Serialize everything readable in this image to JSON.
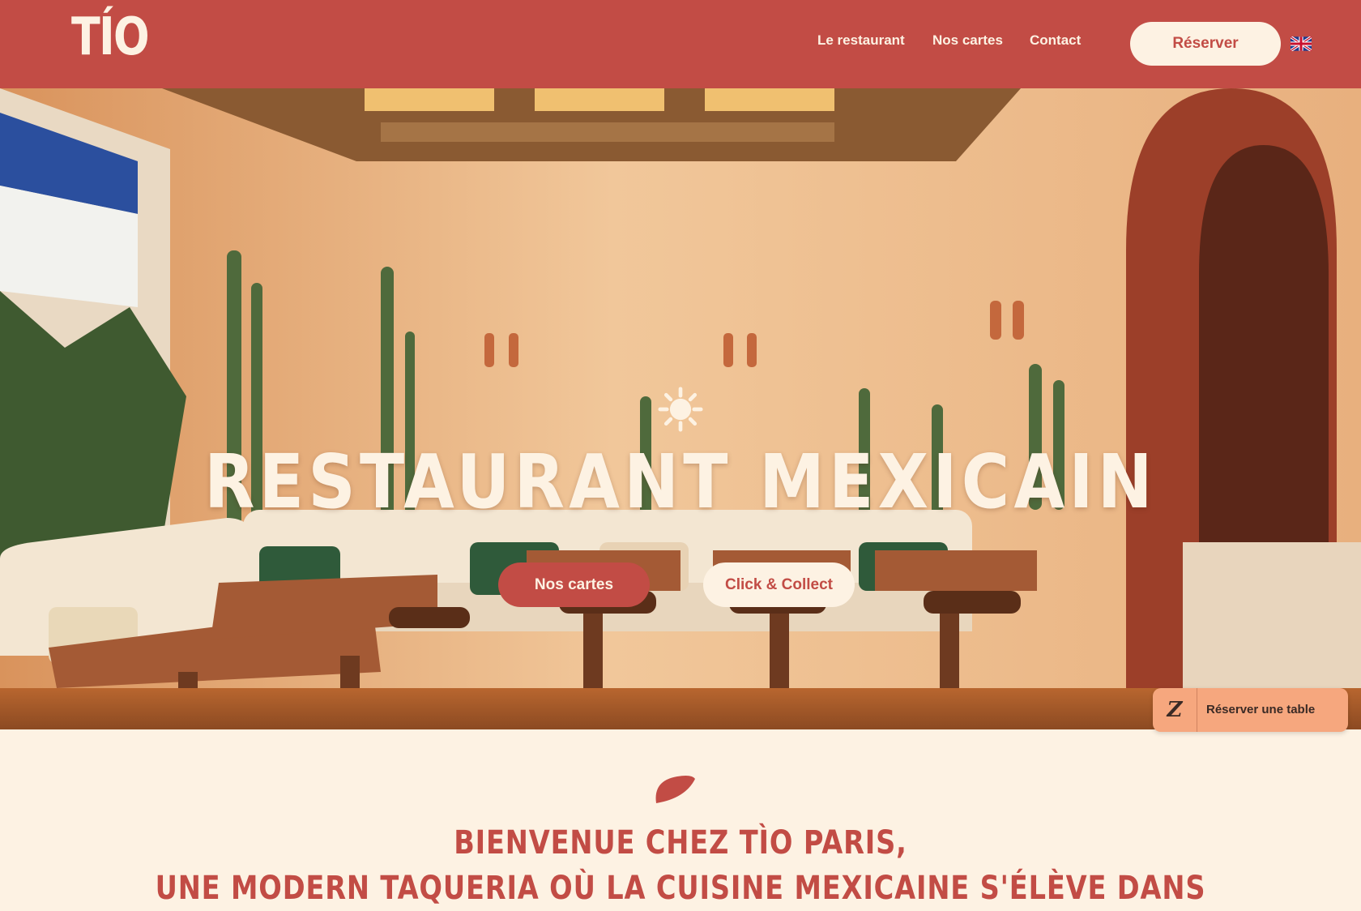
{
  "header": {
    "logo_text": "TÍO",
    "nav": [
      {
        "label": "Le restaurant"
      },
      {
        "label": "Nos cartes"
      },
      {
        "label": "Contact"
      }
    ],
    "reserve_label": "Réserver",
    "language_icon": "uk-flag-icon"
  },
  "hero": {
    "icon": "sun-icon",
    "title": "RESTAURANT MEXICAIN",
    "buttons": [
      {
        "label": "Nos cartes"
      },
      {
        "label": "Click & Collect"
      }
    ]
  },
  "widget": {
    "icon_text": "Z",
    "label": "Réserver une table"
  },
  "welcome": {
    "icon": "leaf-icon",
    "lines": [
      "BIENVENUE CHEZ TÌO PARIS,",
      "UNE MODERN TAQUERIA OÙ LA CUISINE MEXICAINE S'ÉLÈVE DANS"
    ]
  },
  "colors": {
    "brand_red": "#c24c45",
    "cream": "#fdf2e3",
    "widget_orange": "#f6a77e"
  }
}
